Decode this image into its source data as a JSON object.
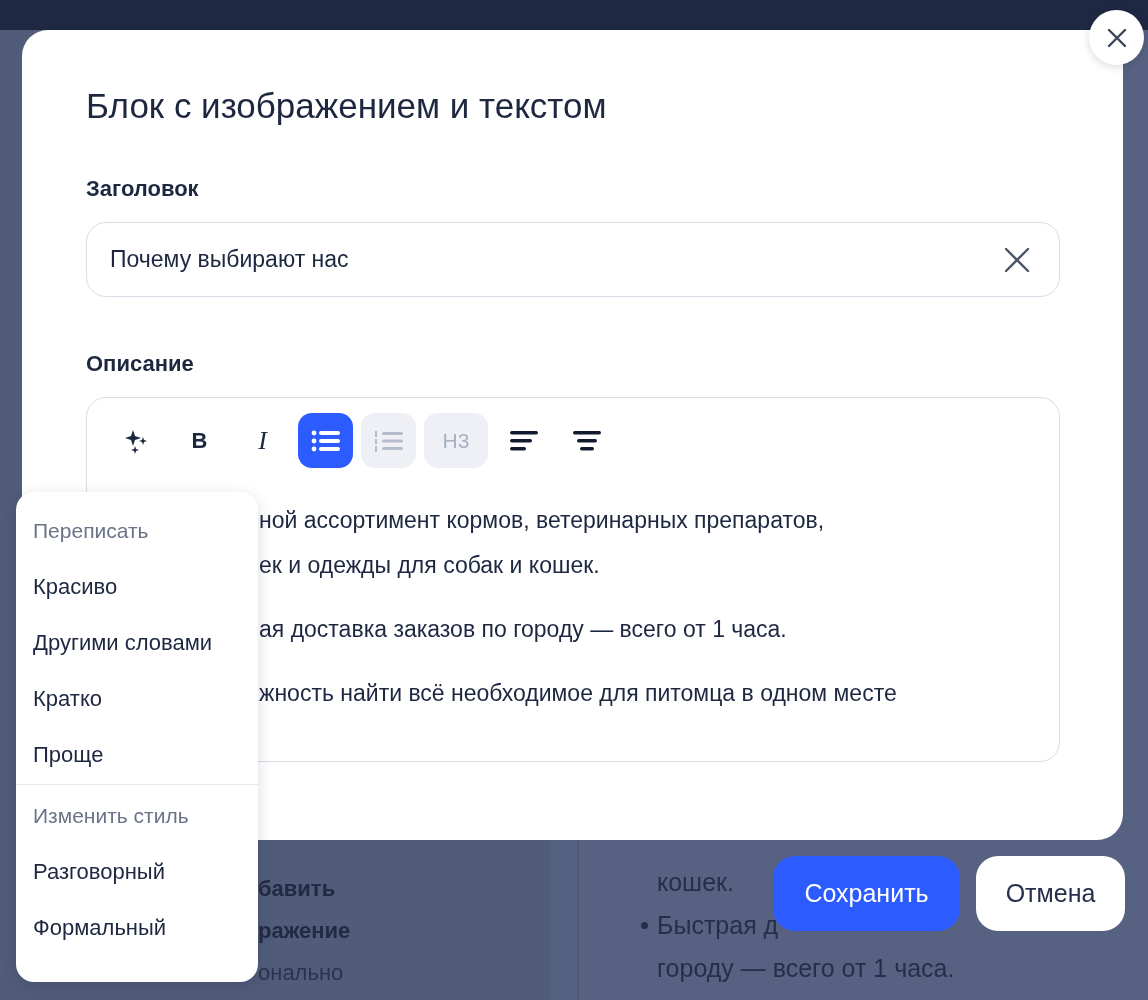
{
  "background_page": {
    "left_texts": [
      {
        "text": "бавить",
        "bold": true
      },
      {
        "text": "ражение",
        "bold": true
      },
      {
        "text": "онально",
        "bold": false
      }
    ],
    "right_lines": [
      {
        "text": "кошек.",
        "bullet": false
      },
      {
        "text": "Быстрая д",
        "bullet": true
      },
      {
        "text": "городу — всего от 1 часа.",
        "bullet": false
      }
    ]
  },
  "dialog": {
    "title": "Блок с изображением и текстом",
    "heading_field": {
      "label": "Заголовок",
      "value": "Почему выбирают нас"
    },
    "description": {
      "label": "Описание",
      "toolbar": [
        {
          "kind": "ai",
          "selected": false,
          "disabled": false
        },
        {
          "kind": "bold",
          "text": "B",
          "selected": false,
          "disabled": false
        },
        {
          "kind": "italic",
          "text": "I",
          "selected": false,
          "disabled": false
        },
        {
          "kind": "bullets",
          "selected": true,
          "disabled": false
        },
        {
          "kind": "numbers",
          "selected": false,
          "disabled": true
        },
        {
          "kind": "h3",
          "text": "H3",
          "selected": false,
          "disabled": true
        },
        {
          "kind": "align-left",
          "selected": false,
          "disabled": false
        },
        {
          "kind": "align-center",
          "selected": false,
          "disabled": false
        }
      ],
      "items": [
        [
          "ной ассортимент кормов, ветеринарных препаратов,",
          "ек и одежды для собак и кошек."
        ],
        [
          "ая доставка заказов по городу — всего от 1 часа."
        ],
        [
          "жность найти всё необходимое для питомца в одном месте"
        ]
      ]
    }
  },
  "rewrite_menu": {
    "sections": [
      {
        "header": "Переписать",
        "items": [
          "Красиво",
          "Другими словами",
          "Кратко",
          "Проще"
        ]
      },
      {
        "header": "Изменить стиль",
        "items": [
          "Разговорный",
          "Формальный"
        ]
      }
    ]
  },
  "buttons": [
    {
      "label": "Сохранить",
      "kind": "primary"
    },
    {
      "label": "Отмена",
      "kind": "secondary"
    }
  ]
}
